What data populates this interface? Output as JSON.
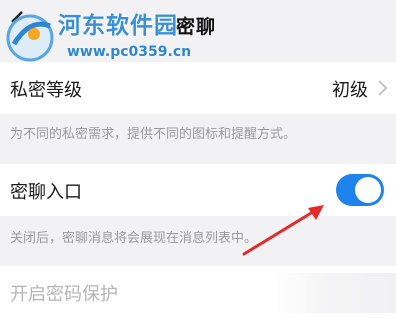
{
  "header": {
    "title": "密聊"
  },
  "watermark": {
    "site_name": "河东软件园",
    "url": "www.pc0359.cn"
  },
  "settings": {
    "privacy_level": {
      "label": "私密等级",
      "value": "初级",
      "hint": "为不同的私密需求，提供不同的图标和提醒方式。"
    },
    "secret_chat_entry": {
      "label": "密聊入口",
      "enabled": true,
      "hint": "关闭后，密聊消息将会展现在消息列表中。"
    },
    "password_protection": {
      "label": "开启密码保护",
      "disabled": true
    }
  },
  "colors": {
    "toggle_on": "#1e83ec",
    "annotation_arrow": "#e62a2a",
    "watermark": "#3a8fd6"
  }
}
